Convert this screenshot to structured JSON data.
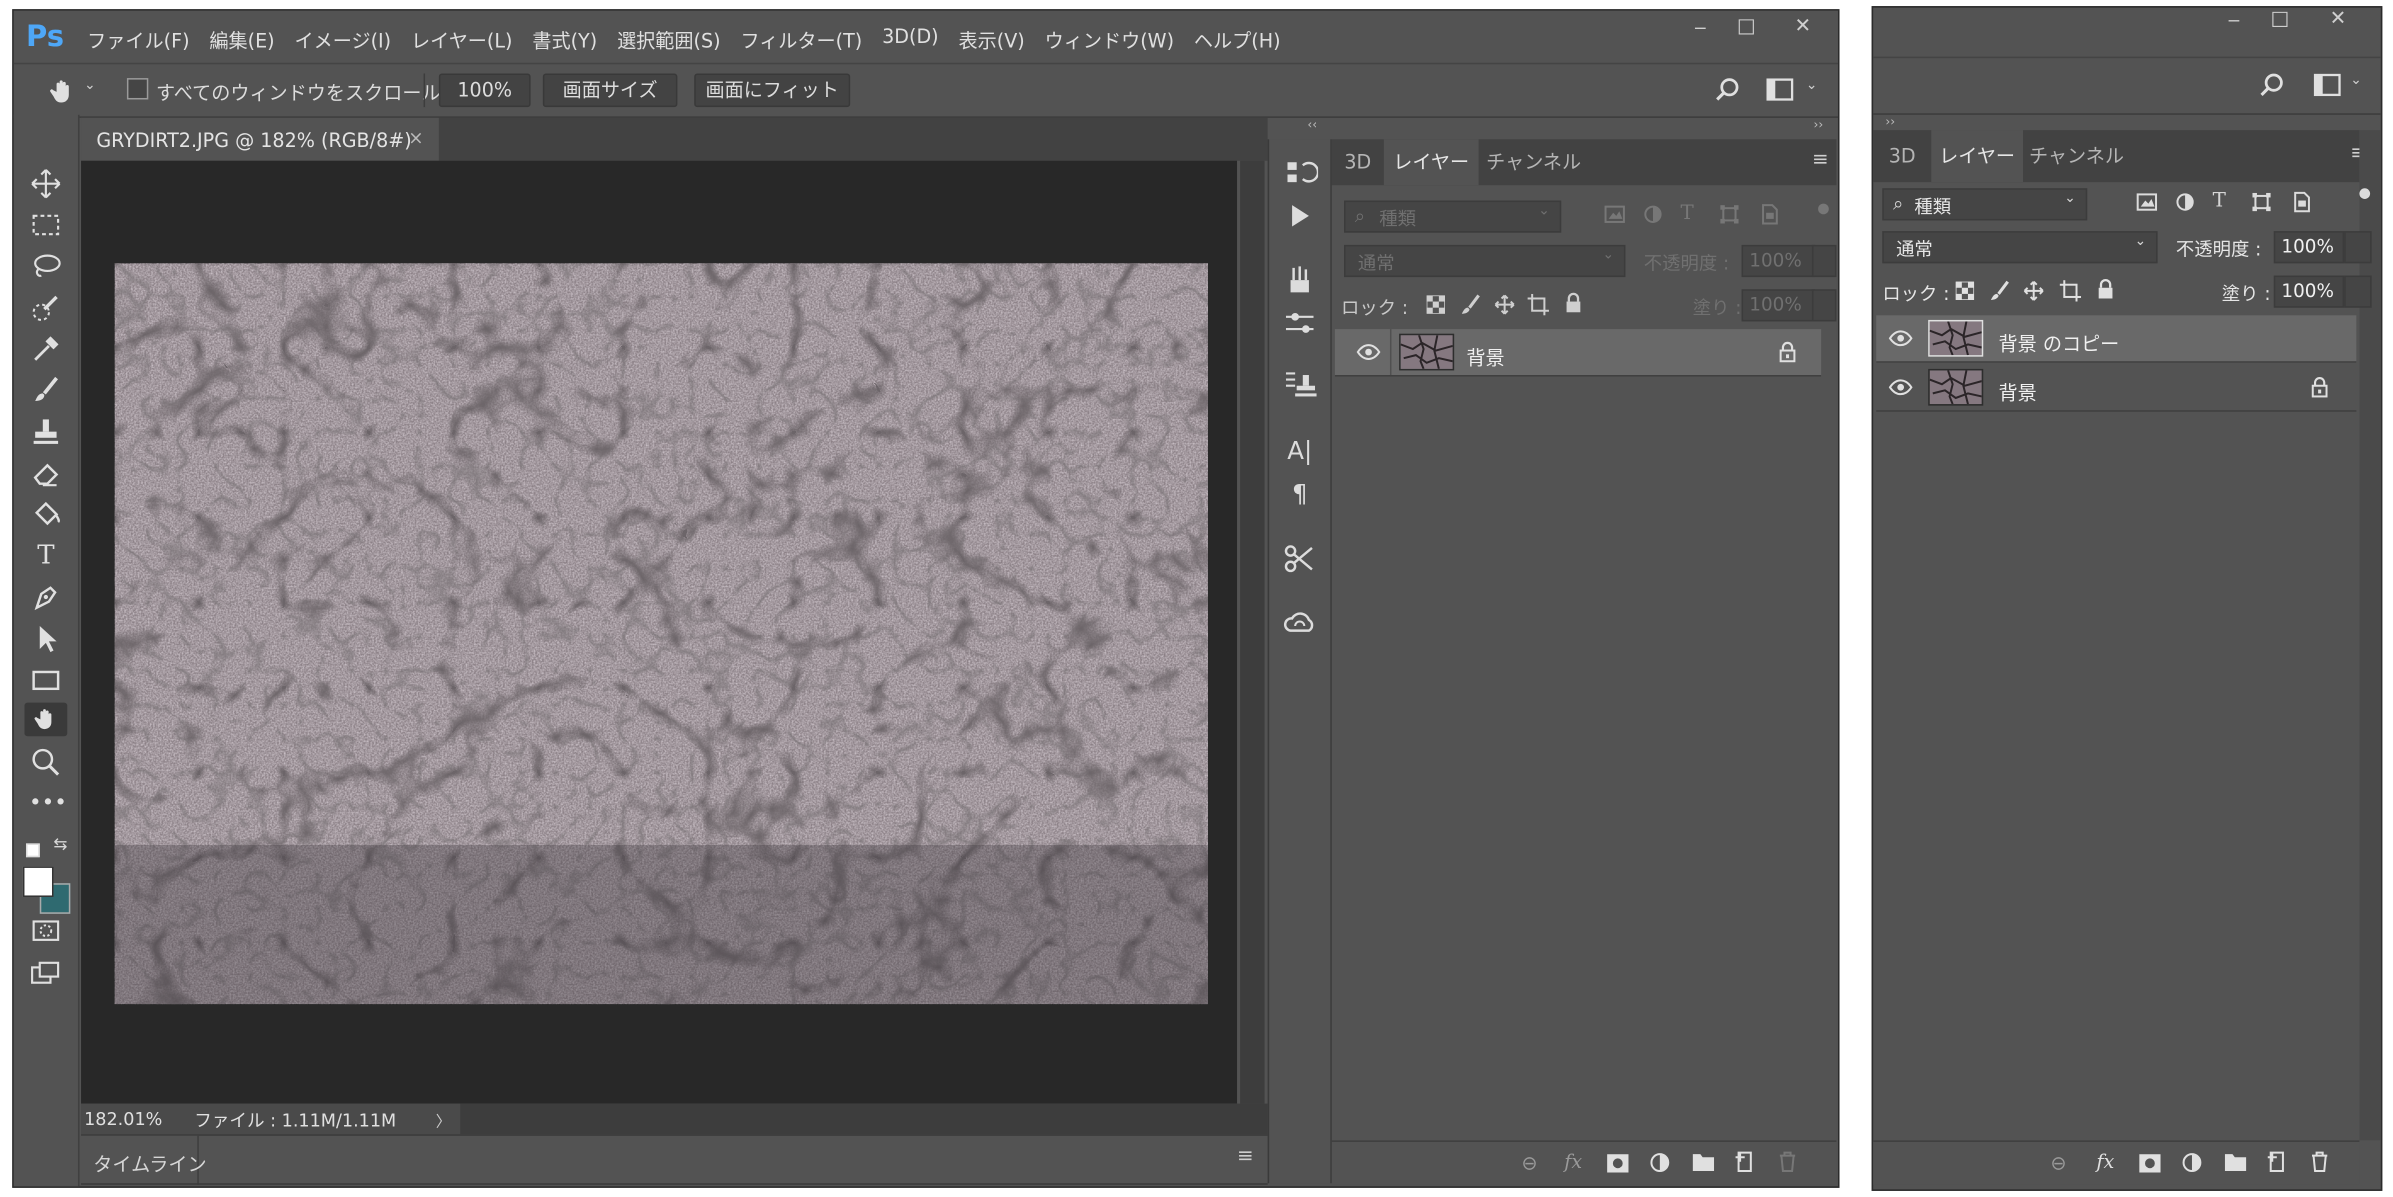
{
  "app": {
    "logo": "Ps"
  },
  "menu": [
    "ファイル(F)",
    "編集(E)",
    "イメージ(I)",
    "レイヤー(L)",
    "書式(Y)",
    "選択範囲(S)",
    "フィルター(T)",
    "3D(D)",
    "表示(V)",
    "ウィンドウ(W)",
    "ヘルプ(H)"
  ],
  "window_controls": {
    "minimize": "‒",
    "maximize": "□",
    "close": "✕"
  },
  "options_bar": {
    "scroll_all_windows_label": "すべてのウィンドウをスクロール",
    "scroll_all_windows_checked": false,
    "zoom_value": "100%",
    "fit_screen_label": "画面サイズ",
    "fill_screen_label": "画面にフィット"
  },
  "document": {
    "tab_title": "GRYDIRT2.JPG @ 182% (RGB/8#)",
    "close_glyph": "×",
    "zoom_readout": "182.01%",
    "file_info": "ファイル : 1.11M/1.11M",
    "status_arrow": "〉"
  },
  "timeline": {
    "label": "タイムライン"
  },
  "main_layers_panel": {
    "tabs": [
      "3D",
      "レイヤー",
      "チャンネル"
    ],
    "active_tab": 1,
    "kind_label": "種類",
    "blend_mode": "通常",
    "opacity_label": "不透明度 :",
    "opacity_value": "100%",
    "lock_label": "ロック :",
    "fill_label": "塗り :",
    "fill_value": "100%",
    "layers": [
      {
        "name": "背景",
        "locked": true,
        "visible": true,
        "selected": true
      }
    ]
  },
  "side_layers_panel": {
    "tabs": [
      "3D",
      "レイヤー",
      "チャンネル"
    ],
    "active_tab": 1,
    "kind_label": "種類",
    "blend_mode": "通常",
    "opacity_label": "不透明度 :",
    "opacity_value": "100%",
    "lock_label": "ロック :",
    "fill_label": "塗り :",
    "fill_value": "100%",
    "layers": [
      {
        "name": "背景 のコピー",
        "locked": false,
        "visible": true,
        "selected": true
      },
      {
        "name": "背景",
        "locked": true,
        "visible": true,
        "selected": false
      }
    ]
  },
  "panel_footer_icons": [
    "link-icon",
    "fx-icon",
    "mask-icon",
    "adjustment-icon",
    "folder-icon",
    "new-layer-icon",
    "trash-icon"
  ],
  "colors": {
    "ui_bg": "#535353",
    "ui_dark": "#424242",
    "canvas_bg": "#282828",
    "accent_logo": "#4ea7f7",
    "background_swatch": "#2f6a70"
  }
}
